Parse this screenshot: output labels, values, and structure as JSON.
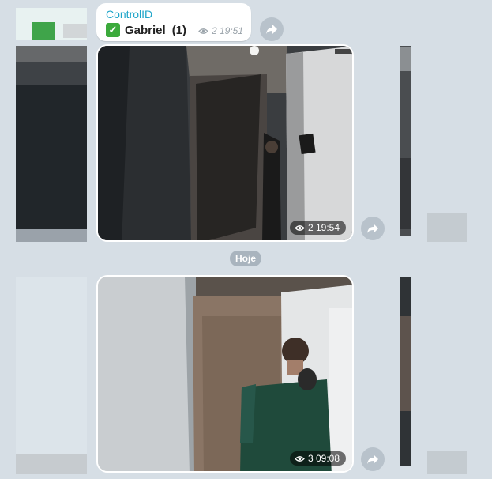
{
  "message": {
    "sender": "ControlID",
    "check_glyph": "✓",
    "name": "Gabriel",
    "count": "(1)",
    "views": "2",
    "time": "19:51"
  },
  "media": [
    {
      "views": "2",
      "time": "19:54"
    },
    {
      "views": "3",
      "time": "09:08"
    }
  ],
  "date_separator": "Hoje",
  "icons": {
    "forward": "forward-arrow-icon",
    "views": "eye-icon",
    "check": "green-check-emoji"
  },
  "colors": {
    "background": "#d6dee5",
    "sender": "#1ea5c9",
    "check_emoji": "#3caa3c",
    "share_button": "#b8c2cb"
  }
}
